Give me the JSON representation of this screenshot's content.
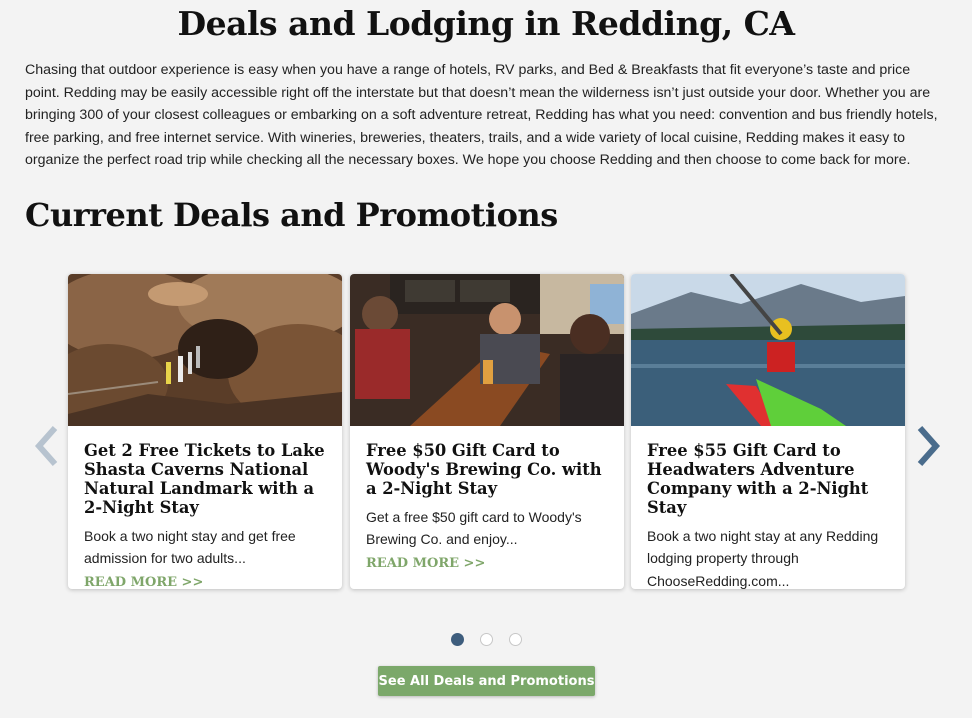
{
  "page": {
    "title": "Deals and Lodging in Redding, CA",
    "intro": "Chasing that outdoor experience is easy when you have a range of hotels, RV parks, and Bed & Breakfasts that fit everyone’s taste and price point. Redding may be easily accessible right off the interstate but that doesn’t mean the wilderness isn’t just outside your door. Whether you are bringing 300 of your closest colleagues or embarking on a soft adventure retreat, Redding has what you need: convention and bus friendly hotels, free parking, and free internet service. With wineries, breweries, theaters, trails, and a wide variety of local cuisine, Redding makes it easy to organize the perfect road trip while checking all the necessary boxes. We hope you choose Redding and then choose to come back for more."
  },
  "deals": {
    "section_title": "Current Deals and Promotions",
    "cards": [
      {
        "title": "Get 2 Free Tickets to Lake Shasta Caverns National Natural Landmark with a 2-Night Stay",
        "description": "Book a two night stay and get free admission for two adults...",
        "read_more": "READ MORE >>"
      },
      {
        "title": "Free $50 Gift Card to Woody's Brewing Co. with a 2-Night Stay",
        "description": "Get a free $50 gift card to Woody's Brewing Co. and enjoy...",
        "read_more": "READ MORE >>"
      },
      {
        "title": "Free $55 Gift Card to Headwaters Adventure Company with a 2-Night Stay",
        "description": "Book a two night stay at any Redding lodging property through ChooseRedding.com...",
        "read_more": ""
      }
    ],
    "carousel": {
      "total_pages": 3,
      "active_page": 1
    },
    "see_all_label": "See All Deals and Promotions"
  },
  "colors": {
    "background": "#f3f3f3",
    "accent_green": "#7ba86a",
    "nav_blue": "#3e5d7d"
  }
}
